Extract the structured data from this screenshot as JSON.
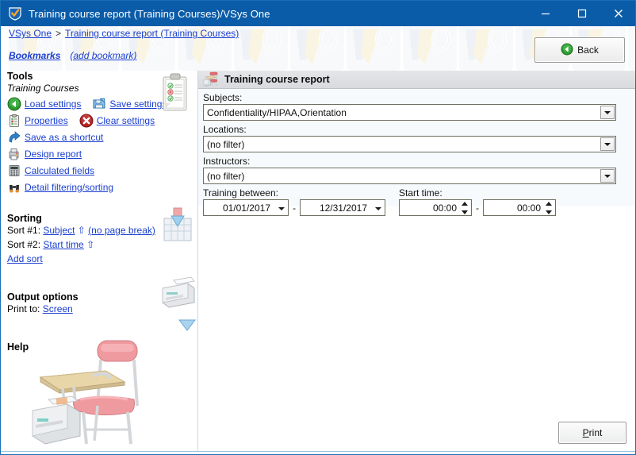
{
  "window": {
    "title": "Training course report (Training Courses)/VSys One",
    "app_icon": "shield-check-icon",
    "minimize_label": "—",
    "maximize_label": "□",
    "close_label": "✕"
  },
  "breadcrumb": {
    "root": "VSys One",
    "separator": ">",
    "current": "Training course report (Training Courses)"
  },
  "bookmarks": {
    "label": "Bookmarks",
    "add_label": "(add bookmark)"
  },
  "back_button": {
    "label": "Back",
    "icon": "green-back-arrow-icon"
  },
  "sidebar": {
    "tools_heading": "Tools",
    "tools_subheading": "Training Courses",
    "tools": [
      {
        "label": "Load settings",
        "icon": "green-back-arrow-icon"
      },
      {
        "label": "Save settings",
        "icon": "floppy-disk-icon"
      },
      {
        "label": "Properties",
        "icon": "clipboard-icon"
      },
      {
        "label": "Clear settings",
        "icon": "red-x-circle-icon"
      },
      {
        "label": "Save as a shortcut",
        "icon": "blue-shortcut-arrow-icon"
      },
      {
        "label": "Design report",
        "icon": "printer-small-icon"
      },
      {
        "label": "Calculated fields",
        "icon": "calculator-icon"
      },
      {
        "label": "Detail filtering/sorting",
        "icon": "binoculars-icon"
      }
    ],
    "sorting_heading": "Sorting",
    "sorts": [
      {
        "prefix": "Sort #1:",
        "field": "Subject",
        "arrow": "⇧",
        "note": "(no page break)"
      },
      {
        "prefix": "Sort #2:",
        "field": "Start time",
        "arrow": "⇧",
        "note": ""
      }
    ],
    "add_sort_label": "Add sort",
    "output_heading": "Output options",
    "print_to_label": "Print to:",
    "print_to_value": "Screen",
    "help_heading": "Help",
    "help_toggle_icon": "blue-triangle-down-icon",
    "art": {
      "clipboard": "clipboard-checklist-art",
      "sortbox": "sort-into-box-art",
      "printer": "printer-art",
      "desk": "school-desk-chair-printer-art"
    }
  },
  "report": {
    "header_title": "Training course report",
    "header_icon": "school-desk-icon",
    "fields": [
      {
        "label": "Subjects:",
        "value": "Confidentiality/HIPAA,Orientation",
        "name": "subjects"
      },
      {
        "label": "Locations:",
        "value": "(no filter)",
        "name": "locations"
      },
      {
        "label": "Instructors:",
        "value": "(no filter)",
        "name": "instructors"
      }
    ],
    "training_between": {
      "label": "Training between:",
      "from": "01/01/2017",
      "to": "12/31/2017",
      "separator": "-"
    },
    "start_time": {
      "label": "Start time:",
      "from": "00:00",
      "to": "00:00",
      "separator": "-"
    }
  },
  "footer": {
    "print_accel": "P",
    "print_rest": "rint"
  },
  "colors": {
    "titlebar": "#0b5ca8",
    "link": "#1a3fd0",
    "panel_bg": "#f7fafd",
    "panel_header": "#dcdee1"
  }
}
